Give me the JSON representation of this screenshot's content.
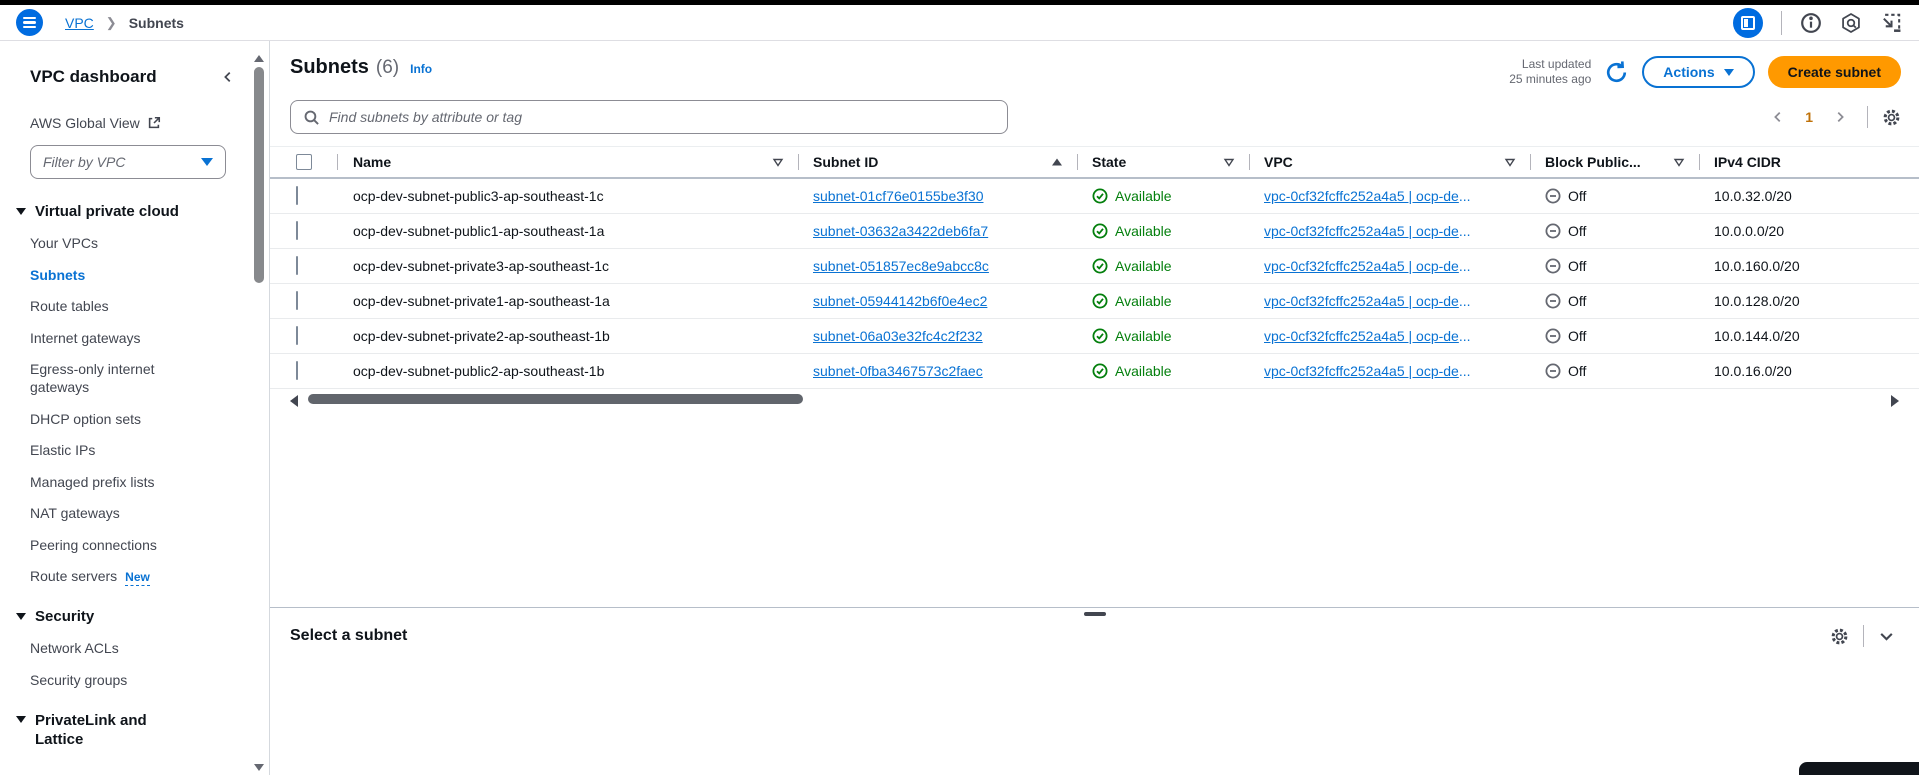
{
  "topbar": {
    "breadcrumb": {
      "root": "VPC",
      "current": "Subnets"
    }
  },
  "sidebar": {
    "title": "VPC dashboard",
    "global_view_label": "AWS Global View",
    "filter_placeholder": "Filter by VPC",
    "sections": [
      {
        "label": "Virtual private cloud",
        "items": [
          {
            "label": "Your VPCs"
          },
          {
            "label": "Subnets",
            "active": true
          },
          {
            "label": "Route tables"
          },
          {
            "label": "Internet gateways"
          },
          {
            "label": "Egress-only internet gateways"
          },
          {
            "label": "DHCP option sets"
          },
          {
            "label": "Elastic IPs"
          },
          {
            "label": "Managed prefix lists"
          },
          {
            "label": "NAT gateways"
          },
          {
            "label": "Peering connections"
          },
          {
            "label": "Route servers",
            "badge": "New"
          }
        ]
      },
      {
        "label": "Security",
        "items": [
          {
            "label": "Network ACLs"
          },
          {
            "label": "Security groups"
          }
        ]
      },
      {
        "label": "PrivateLink and Lattice",
        "items": []
      }
    ]
  },
  "main": {
    "title": "Subnets",
    "count": "(6)",
    "info_label": "Info",
    "last_updated_line1": "Last updated",
    "last_updated_line2": "25 minutes ago",
    "actions_label": "Actions",
    "create_label": "Create subnet",
    "search_placeholder": "Find subnets by attribute or tag",
    "page_number": "1",
    "table": {
      "columns": [
        "Name",
        "Subnet ID",
        "State",
        "VPC",
        "Block Public...",
        "IPv4 CIDR"
      ],
      "ellipsis": "...",
      "rows": [
        {
          "name": "ocp-dev-subnet-public3-ap-southeast-1c",
          "subnet_id": "subnet-01cf76e0155be3f30",
          "state": "Available",
          "vpc": "vpc-0cf32fcffc252a4a5 | ocp-de",
          "block_public": "Off",
          "ipv4_cidr": "10.0.32.0/20"
        },
        {
          "name": "ocp-dev-subnet-public1-ap-southeast-1a",
          "subnet_id": "subnet-03632a3422deb6fa7",
          "state": "Available",
          "vpc": "vpc-0cf32fcffc252a4a5 | ocp-de",
          "block_public": "Off",
          "ipv4_cidr": "10.0.0.0/20"
        },
        {
          "name": "ocp-dev-subnet-private3-ap-southeast-1c",
          "subnet_id": "subnet-051857ec8e9abcc8c",
          "state": "Available",
          "vpc": "vpc-0cf32fcffc252a4a5 | ocp-de",
          "block_public": "Off",
          "ipv4_cidr": "10.0.160.0/20"
        },
        {
          "name": "ocp-dev-subnet-private1-ap-southeast-1a",
          "subnet_id": "subnet-05944142b6f0e4ec2",
          "state": "Available",
          "vpc": "vpc-0cf32fcffc252a4a5 | ocp-de",
          "block_public": "Off",
          "ipv4_cidr": "10.0.128.0/20"
        },
        {
          "name": "ocp-dev-subnet-private2-ap-southeast-1b",
          "subnet_id": "subnet-06a03e32fc4c2f232",
          "state": "Available",
          "vpc": "vpc-0cf32fcffc252a4a5 | ocp-de",
          "block_public": "Off",
          "ipv4_cidr": "10.0.144.0/20"
        },
        {
          "name": "ocp-dev-subnet-public2-ap-southeast-1b",
          "subnet_id": "subnet-0fba3467573c2faec",
          "state": "Available",
          "vpc": "vpc-0cf32fcffc252a4a5 | ocp-de",
          "block_public": "Off",
          "ipv4_cidr": "10.0.16.0/20"
        }
      ]
    }
  },
  "bottom_panel": {
    "title": "Select a subnet"
  },
  "colors": {
    "link_blue": "#0972d3",
    "brand_blue": "#006ce0",
    "status_green": "#037f0c",
    "primary_orange": "#ff9900",
    "page_current": "#bf7108",
    "text_dark": "#0f141a",
    "text_muted": "#656871"
  }
}
